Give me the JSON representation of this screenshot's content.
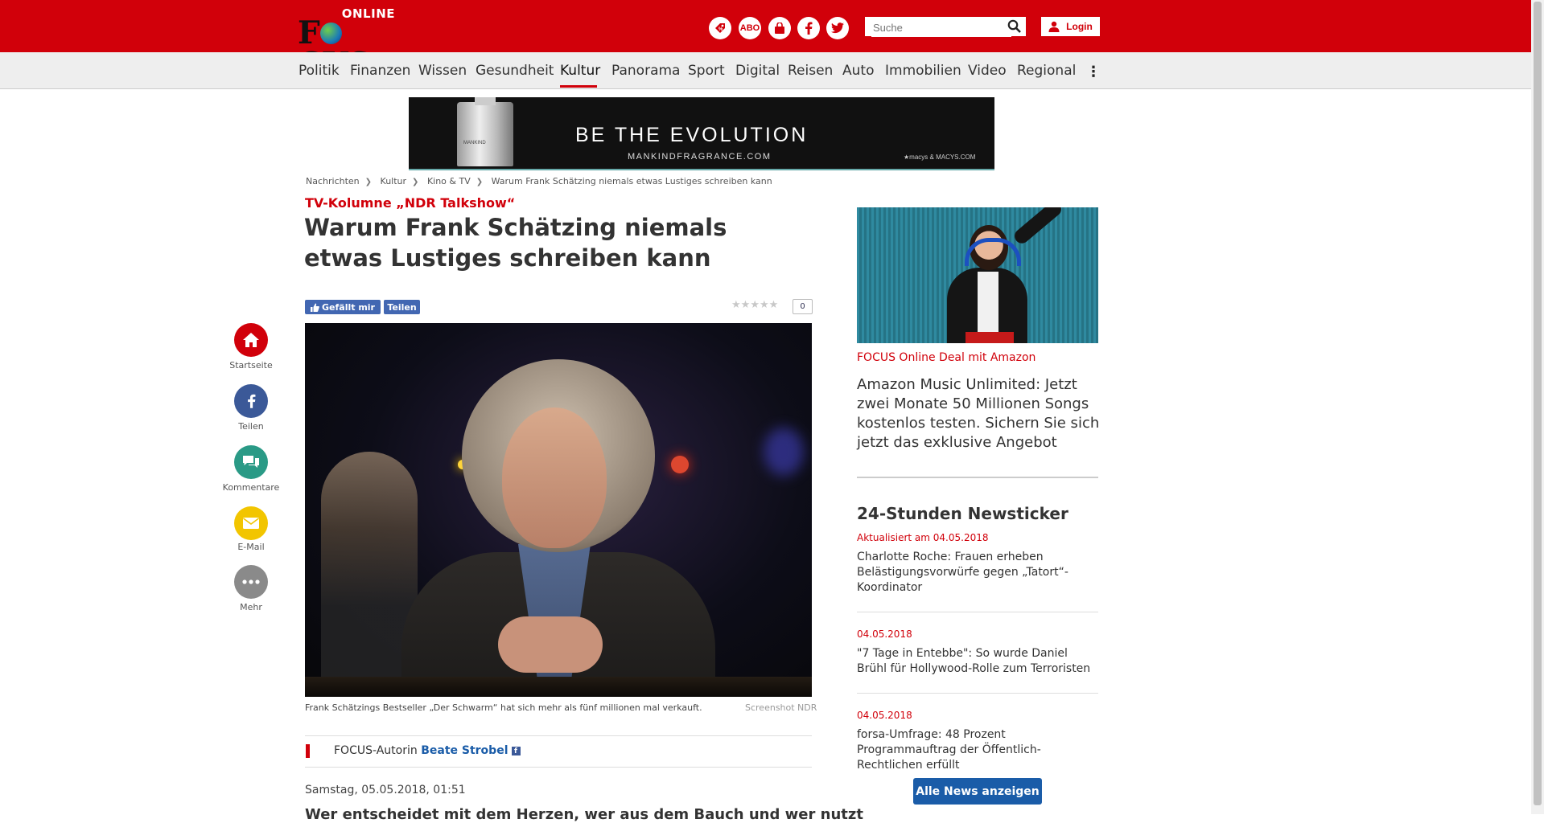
{
  "header": {
    "logo_online": "ONLINE",
    "logo_focus_left": "F",
    "logo_focus_right": "CUS",
    "icons": [
      "voucher-icon",
      "abo-icon",
      "shopping-bag-icon",
      "facebook-icon",
      "twitter-icon"
    ],
    "abo_label": "ABO",
    "search_placeholder": "Suche",
    "login_label": "Login",
    "brand_color": "#d1000a"
  },
  "nav": {
    "items": [
      "Politik",
      "Finanzen",
      "Wissen",
      "Gesundheit",
      "Kultur",
      "Panorama",
      "Sport",
      "Digital",
      "Reisen",
      "Auto",
      "Immobilien",
      "Video",
      "Regional"
    ],
    "active": "Kultur"
  },
  "ad": {
    "slogan": "BE THE EVOLUTION",
    "url": "MANKINDFRAGRANCE.COM",
    "retailer": "★macys & MACYS.COM",
    "bottle_label": "MANKIND"
  },
  "breadcrumb": [
    "Nachrichten",
    "Kultur",
    "Kino & TV",
    "Warum Frank Schätzing niemals etwas Lustiges schreiben kann"
  ],
  "article": {
    "kicker": "TV-Kolumne „NDR Talkshow“",
    "headline": "Warum Frank Schätzing niemals etwas Lustiges schreiben kann",
    "like_label": "Gefällt mir",
    "share_label": "Teilen",
    "rating_stars": 0,
    "rating_count": "0",
    "caption": "Frank Schätzings Bestseller „Der Schwarm“ hat sich mehr als fünf millionen mal verkauft.",
    "credit": "Screenshot NDR",
    "author_prefix": "FOCUS-Autorin",
    "author_name": "Beate Strobel",
    "date": "Samstag, 05.05.2018, 01:51",
    "lead_start": "Wer entscheidet mit dem Herzen, wer aus dem Bauch und wer nutzt"
  },
  "social": [
    {
      "label": "Startseite",
      "icon": "home-icon",
      "color": "#d1000a"
    },
    {
      "label": "Teilen",
      "icon": "facebook-icon",
      "color": "#3b5998"
    },
    {
      "label": "Kommentare",
      "icon": "comments-icon",
      "color": "#2a9a86"
    },
    {
      "label": "E-Mail",
      "icon": "mail-icon",
      "color": "#f2c500"
    },
    {
      "label": "Mehr",
      "icon": "more-icon",
      "color": "#8a8a8a"
    }
  ],
  "sidebar": {
    "deal_label": "FOCUS Online Deal mit Amazon",
    "deal_text": "Amazon Music Unlimited: Jetzt zwei Monate 50 Millionen Songs kostenlos testen. Sichern Sie sich jetzt das exklusive Angebot",
    "ticker_title": "24-Stunden Newsticker",
    "ticker": [
      {
        "date": "Aktualisiert am 04.05.2018",
        "text": "Charlotte Roche: Frauen erheben Belästigungsvorwürfe gegen „Tatort“-Koordinator"
      },
      {
        "date": "04.05.2018",
        "text": "\"7 Tage in Entebbe\": So wurde Daniel Brühl für Hollywood-Rolle zum Terroristen"
      },
      {
        "date": "04.05.2018",
        "text": "forsa-Umfrage: 48 Prozent Programmauftrag der Öffentlich-Rechtlichen erfüllt"
      }
    ],
    "all_news_label": "Alle News anzeigen"
  }
}
